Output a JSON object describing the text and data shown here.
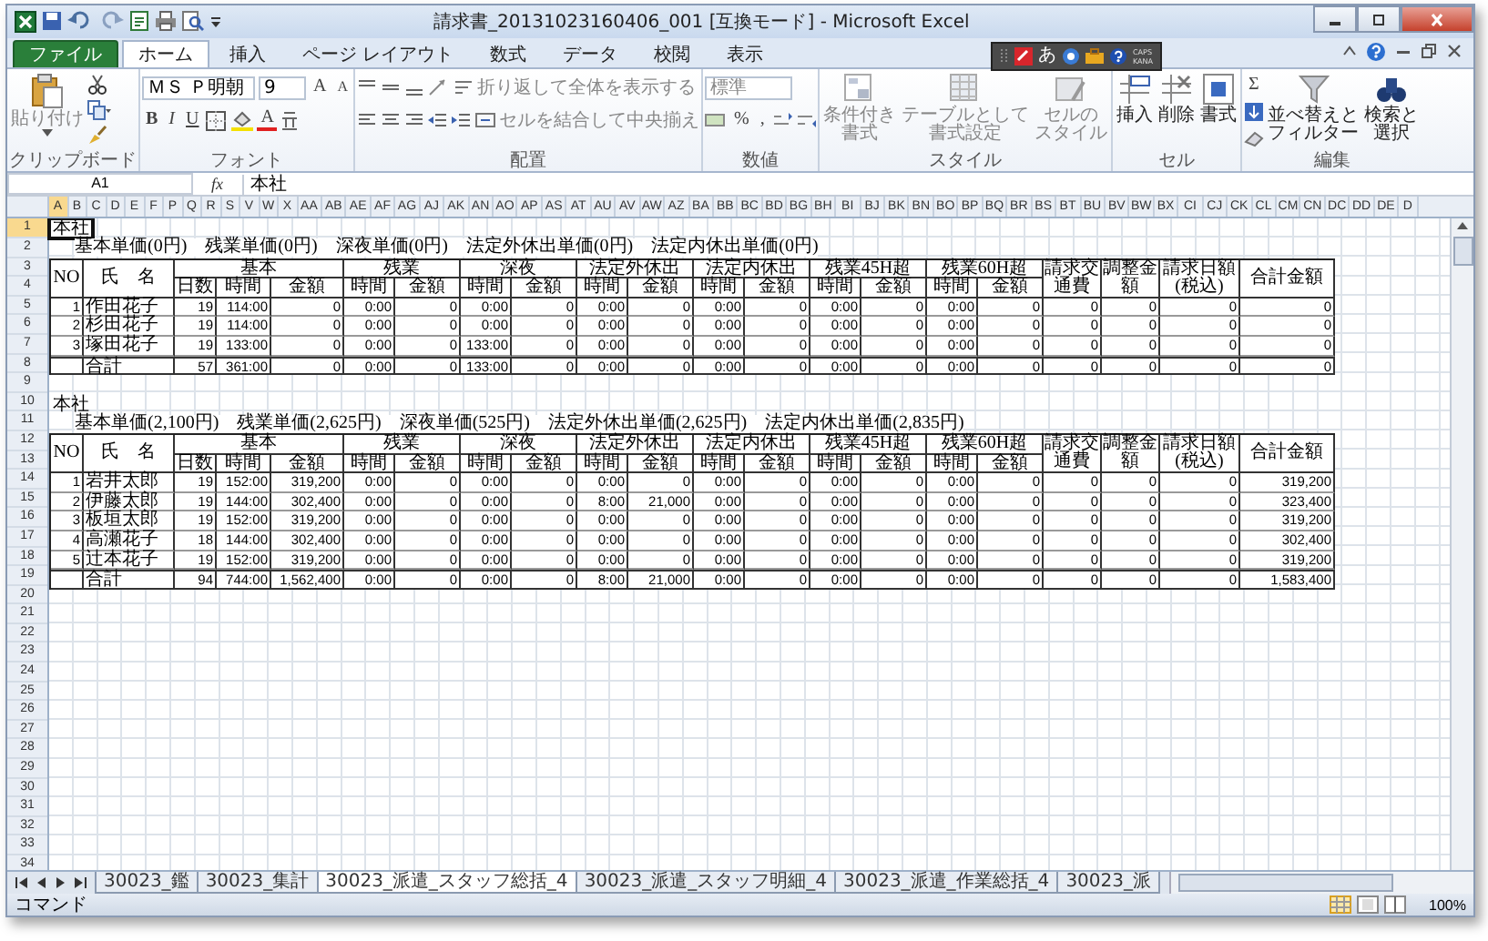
{
  "window": {
    "title": "請求書_20131023160406_001 [互換モード] - Microsoft Excel"
  },
  "menu_tabs": [
    {
      "label": "ファイル",
      "kind": "file",
      "selected": false
    },
    {
      "label": "ホーム",
      "kind": "tab",
      "selected": true
    },
    {
      "label": "挿入",
      "kind": "tab",
      "selected": false
    },
    {
      "label": "ページ レイアウト",
      "kind": "tab",
      "selected": false
    },
    {
      "label": "数式",
      "kind": "tab",
      "selected": false
    },
    {
      "label": "データ",
      "kind": "tab",
      "selected": false
    },
    {
      "label": "校閲",
      "kind": "tab",
      "selected": false
    },
    {
      "label": "表示",
      "kind": "tab",
      "selected": false
    }
  ],
  "ime_bar": {
    "mode": "あ",
    "caps": "CAPS",
    "kana": "KANA"
  },
  "ribbon": {
    "clipboard": {
      "label": "クリップボード",
      "paste": "貼り付け"
    },
    "font": {
      "label": "フォント",
      "font_name": "ＭＳ Ｐ明朝",
      "font_size": "9",
      "grow": "A",
      "shrink": "A",
      "bold": "B",
      "italic": "I",
      "underline": "U",
      "font_color": "A"
    },
    "alignment": {
      "label": "配置",
      "wrap_text": "折り返して全体を表示する",
      "merge_center": "セルを結合して中央揃え"
    },
    "number": {
      "label": "数値",
      "format": "標準",
      "percent": "%",
      "comma": ","
    },
    "styles": {
      "label": "スタイル",
      "conditional": [
        "条件付き",
        "書式"
      ],
      "table": [
        "テーブルとして",
        "書式設定"
      ],
      "cell_styles": [
        "セルの",
        "スタイル"
      ]
    },
    "cells": {
      "label": "セル",
      "insert": "挿入",
      "delete": "削除",
      "format": "書式"
    },
    "editing": {
      "label": "編集",
      "autosum": "Σ",
      "sort_filter": [
        "並べ替えと",
        "フィルター"
      ],
      "find_select": [
        "検索と",
        "選択"
      ]
    }
  },
  "formula_bar": {
    "name_box": "A1",
    "fx": "fx",
    "value": "本社"
  },
  "columns": [
    {
      "label": "A",
      "selected": true
    },
    {
      "label": "B",
      "selected": false
    },
    {
      "label": "C",
      "selected": false
    },
    {
      "label": "D",
      "selected": false
    },
    {
      "label": "E",
      "selected": false
    },
    {
      "label": "F",
      "selected": false
    },
    {
      "label": "P",
      "selected": false
    },
    {
      "label": "Q",
      "selected": false
    },
    {
      "label": "R",
      "selected": false
    },
    {
      "label": "S",
      "selected": false
    },
    {
      "label": "V",
      "selected": false
    },
    {
      "label": "W",
      "selected": false
    },
    {
      "label": "X",
      "selected": false
    },
    {
      "label": "AA",
      "selected": false
    },
    {
      "label": "AB",
      "selected": false
    },
    {
      "label": "AE",
      "selected": false
    },
    {
      "label": "AF",
      "selected": false
    },
    {
      "label": "AG",
      "selected": false
    },
    {
      "label": "AJ",
      "selected": false
    },
    {
      "label": "AK",
      "selected": false
    },
    {
      "label": "AN",
      "selected": false
    },
    {
      "label": "AO",
      "selected": false
    },
    {
      "label": "AP",
      "selected": false
    },
    {
      "label": "AS",
      "selected": false
    },
    {
      "label": "AT",
      "selected": false
    },
    {
      "label": "AU",
      "selected": false
    },
    {
      "label": "AV",
      "selected": false
    },
    {
      "label": "AW",
      "selected": false
    },
    {
      "label": "AZ",
      "selected": false
    },
    {
      "label": "BA",
      "selected": false
    },
    {
      "label": "BB",
      "selected": false
    },
    {
      "label": "BC",
      "selected": false
    },
    {
      "label": "BD",
      "selected": false
    },
    {
      "label": "BG",
      "selected": false
    },
    {
      "label": "BH",
      "selected": false
    },
    {
      "label": "BI",
      "selected": false
    },
    {
      "label": "BJ",
      "selected": false
    },
    {
      "label": "BK",
      "selected": false
    },
    {
      "label": "BN",
      "selected": false
    },
    {
      "label": "BO",
      "selected": false
    },
    {
      "label": "BP",
      "selected": false
    },
    {
      "label": "BQ",
      "selected": false
    },
    {
      "label": "BR",
      "selected": false
    },
    {
      "label": "BS",
      "selected": false
    },
    {
      "label": "BT",
      "selected": false
    },
    {
      "label": "BU",
      "selected": false
    },
    {
      "label": "BV",
      "selected": false
    },
    {
      "label": "BW",
      "selected": false
    },
    {
      "label": "BX",
      "selected": false
    },
    {
      "label": "CI",
      "selected": false
    },
    {
      "label": "CJ",
      "selected": false
    },
    {
      "label": "CK",
      "selected": false
    },
    {
      "label": "CL",
      "selected": false
    },
    {
      "label": "CM",
      "selected": false
    },
    {
      "label": "CN",
      "selected": false
    },
    {
      "label": "DC",
      "selected": false
    },
    {
      "label": "DD",
      "selected": false
    },
    {
      "label": "DE",
      "selected": false
    },
    {
      "label": "D",
      "selected": false
    }
  ],
  "rows": [
    {
      "label": "1",
      "selected": true
    },
    {
      "label": "2",
      "selected": false
    },
    {
      "label": "3",
      "selected": false
    },
    {
      "label": "4",
      "selected": false
    },
    {
      "label": "5",
      "selected": false
    },
    {
      "label": "6",
      "selected": false
    },
    {
      "label": "7",
      "selected": false
    },
    {
      "label": "8",
      "selected": false
    },
    {
      "label": "9",
      "selected": false
    },
    {
      "label": "10",
      "selected": false
    },
    {
      "label": "11",
      "selected": false
    },
    {
      "label": "12",
      "selected": false
    },
    {
      "label": "13",
      "selected": false
    },
    {
      "label": "14",
      "selected": false
    },
    {
      "label": "15",
      "selected": false
    },
    {
      "label": "16",
      "selected": false
    },
    {
      "label": "17",
      "selected": false
    },
    {
      "label": "18",
      "selected": false
    },
    {
      "label": "19",
      "selected": false
    },
    {
      "label": "20",
      "selected": false
    },
    {
      "label": "21",
      "selected": false
    },
    {
      "label": "22",
      "selected": false
    },
    {
      "label": "23",
      "selected": false
    },
    {
      "label": "24",
      "selected": false
    },
    {
      "label": "25",
      "selected": false
    },
    {
      "label": "26",
      "selected": false
    },
    {
      "label": "27",
      "selected": false
    },
    {
      "label": "28",
      "selected": false
    },
    {
      "label": "29",
      "selected": false
    },
    {
      "label": "30",
      "selected": false
    },
    {
      "label": "31",
      "selected": false
    },
    {
      "label": "32",
      "selected": false
    },
    {
      "label": "33",
      "selected": false
    },
    {
      "label": "34",
      "selected": false
    }
  ],
  "sections": [
    {
      "title": "本社",
      "active": true,
      "rates": "基本単価(0円)　残業単価(0円)　深夜単価(0円)　法定外休出単価(0円)　法定内休出単価(0円)",
      "no_header": "NO",
      "name_header": "氏　名",
      "groups": [
        "基本",
        "残業",
        "深夜",
        "法定外休出",
        "法定内休出",
        "残業45H超",
        "残業60H超"
      ],
      "subheaders": [
        "日数",
        "時間",
        "金額",
        "時間",
        "金額",
        "時間",
        "金額",
        "時間",
        "金額",
        "時間",
        "金額",
        "時間",
        "金額",
        "時間",
        "金額"
      ],
      "extras": [
        "請求交通費",
        "調整金額",
        "請求日額(税込)",
        "合計金額"
      ],
      "rows": [
        {
          "no": "1",
          "name": "作田花子",
          "cells": [
            "19",
            "114:00",
            "0",
            "0:00",
            "0",
            "0:00",
            "0",
            "0:00",
            "0",
            "0:00",
            "0",
            "0:00",
            "0",
            "0:00",
            "0",
            "0",
            "0",
            "0",
            "0"
          ]
        },
        {
          "no": "2",
          "name": "杉田花子",
          "cells": [
            "19",
            "114:00",
            "0",
            "0:00",
            "0",
            "0:00",
            "0",
            "0:00",
            "0",
            "0:00",
            "0",
            "0:00",
            "0",
            "0:00",
            "0",
            "0",
            "0",
            "0",
            "0"
          ]
        },
        {
          "no": "3",
          "name": "塚田花子",
          "cells": [
            "19",
            "133:00",
            "0",
            "0:00",
            "0",
            "133:00",
            "0",
            "0:00",
            "0",
            "0:00",
            "0",
            "0:00",
            "0",
            "0:00",
            "0",
            "0",
            "0",
            "0",
            "0"
          ]
        }
      ],
      "total": {
        "label": "合計",
        "cells": [
          "57",
          "361:00",
          "0",
          "0:00",
          "0",
          "133:00",
          "0",
          "0:00",
          "0",
          "0:00",
          "0",
          "0:00",
          "0",
          "0:00",
          "0",
          "0",
          "0",
          "0",
          "0"
        ]
      }
    },
    {
      "title": "本社",
      "active": false,
      "rates": "基本単価(2,100円)　残業単価(2,625円)　深夜単価(525円)　法定外休出単価(2,625円)　法定内休出単価(2,835円)",
      "no_header": "NO",
      "name_header": "氏　名",
      "groups": [
        "基本",
        "残業",
        "深夜",
        "法定外休出",
        "法定内休出",
        "残業45H超",
        "残業60H超"
      ],
      "subheaders": [
        "日数",
        "時間",
        "金額",
        "時間",
        "金額",
        "時間",
        "金額",
        "時間",
        "金額",
        "時間",
        "金額",
        "時間",
        "金額",
        "時間",
        "金額"
      ],
      "extras": [
        "請求交通費",
        "調整金額",
        "請求日額(税込)",
        "合計金額"
      ],
      "rows": [
        {
          "no": "1",
          "name": "岩井太郎",
          "cells": [
            "19",
            "152:00",
            "319,200",
            "0:00",
            "0",
            "0:00",
            "0",
            "0:00",
            "0",
            "0:00",
            "0",
            "0:00",
            "0",
            "0:00",
            "0",
            "0",
            "0",
            "0",
            "319,200"
          ]
        },
        {
          "no": "2",
          "name": "伊藤太郎",
          "cells": [
            "19",
            "144:00",
            "302,400",
            "0:00",
            "0",
            "0:00",
            "0",
            "8:00",
            "21,000",
            "0:00",
            "0",
            "0:00",
            "0",
            "0:00",
            "0",
            "0",
            "0",
            "0",
            "323,400"
          ]
        },
        {
          "no": "3",
          "name": "板垣太郎",
          "cells": [
            "19",
            "152:00",
            "319,200",
            "0:00",
            "0",
            "0:00",
            "0",
            "0:00",
            "0",
            "0:00",
            "0",
            "0:00",
            "0",
            "0:00",
            "0",
            "0",
            "0",
            "0",
            "319,200"
          ]
        },
        {
          "no": "4",
          "name": "高瀬花子",
          "cells": [
            "18",
            "144:00",
            "302,400",
            "0:00",
            "0",
            "0:00",
            "0",
            "0:00",
            "0",
            "0:00",
            "0",
            "0:00",
            "0",
            "0:00",
            "0",
            "0",
            "0",
            "0",
            "302,400"
          ]
        },
        {
          "no": "5",
          "name": "辻本花子",
          "cells": [
            "19",
            "152:00",
            "319,200",
            "0:00",
            "0",
            "0:00",
            "0",
            "0:00",
            "0",
            "0:00",
            "0",
            "0:00",
            "0",
            "0:00",
            "0",
            "0",
            "0",
            "0",
            "319,200"
          ]
        }
      ],
      "total": {
        "label": "合計",
        "cells": [
          "94",
          "744:00",
          "1,562,400",
          "0:00",
          "0",
          "0:00",
          "0",
          "8:00",
          "21,000",
          "0:00",
          "0",
          "0:00",
          "0",
          "0:00",
          "0",
          "0",
          "0",
          "0",
          "1,583,400"
        ]
      }
    }
  ],
  "sheet_tabs": [
    {
      "label": "30023_鑑",
      "selected": false
    },
    {
      "label": "30023_集計",
      "selected": false
    },
    {
      "label": "30023_派遣_スタッフ総括_4",
      "selected": true
    },
    {
      "label": "30023_派遣_スタッフ明細_4",
      "selected": false
    },
    {
      "label": "30023_派遣_作業総括_4",
      "selected": false
    },
    {
      "label": "30023_派",
      "selected": false
    }
  ],
  "status_bar": {
    "mode": "コマンド",
    "zoom": "100%"
  }
}
